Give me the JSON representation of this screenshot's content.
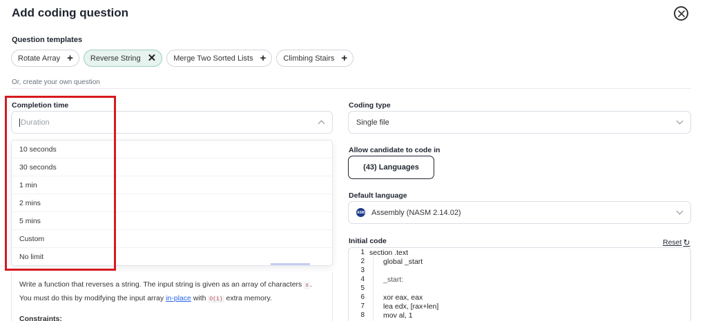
{
  "header": {
    "title": "Add coding question"
  },
  "templates": {
    "label": "Question templates",
    "items": [
      {
        "label": "Rotate Array",
        "icon": "+"
      },
      {
        "label": "Reverse String",
        "icon": "✕"
      },
      {
        "label": "Merge Two Sorted Lists",
        "icon": "+"
      },
      {
        "label": "Climbing Stairs",
        "icon": "+"
      }
    ],
    "create_own": "Or, create your own question"
  },
  "completion_time": {
    "label": "Completion time",
    "placeholder": "Duration",
    "options": [
      "10 seconds",
      "30 seconds",
      "1 min",
      "2 mins",
      "5 mins",
      "Custom",
      "No limit"
    ]
  },
  "description": {
    "line1_text": "Write a function that reverses a string. The input string is given as an array of characters",
    "line1_code": "s",
    "line1_end": ".",
    "line2_start": "You must do this by modifying the input array",
    "line2_link": "in-place",
    "line2_mid": "with",
    "line2_code": "O(1)",
    "line2_end": "extra memory.",
    "constraints_label": "Constraints:"
  },
  "coding_type": {
    "label": "Coding type",
    "value": "Single file"
  },
  "candidate_langs": {
    "label": "Allow candidate to code in",
    "button": "(43) Languages"
  },
  "default_language": {
    "label": "Default language",
    "value": "Assembly (NASM 2.14.02)",
    "icon_text": "ASM"
  },
  "initial_code": {
    "label": "Initial code",
    "reset": "Reset",
    "reset_icon": "↻",
    "line_numbers": [
      "1",
      "2",
      "3",
      "4",
      "5",
      "6",
      "7",
      "8"
    ],
    "lines": [
      "section .text",
      "global _start",
      "",
      "_start:",
      "",
      "xor eax, eax",
      "lea edx, [rax+len]",
      "mov al, 1"
    ]
  },
  "colors": {
    "highlight_border": "#d71920",
    "selected_chip_bg": "#e6f3ee",
    "link": "#2563eb"
  }
}
